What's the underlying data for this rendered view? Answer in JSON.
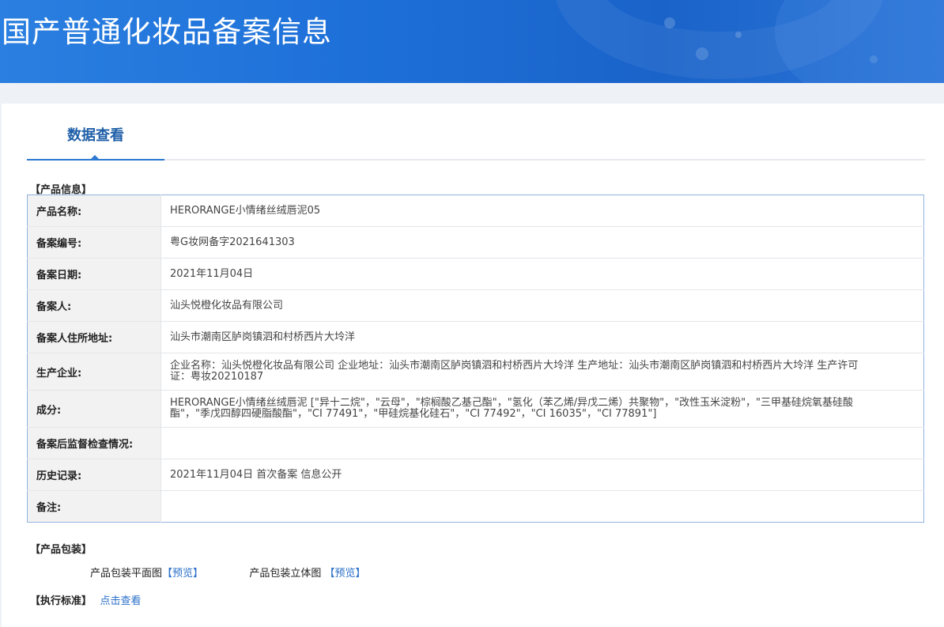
{
  "banner": {
    "title": "国产普通化妆品备案信息"
  },
  "tabs": [
    {
      "label": "数据查看"
    }
  ],
  "product_info": {
    "section_label": "【产品信息】",
    "rows": [
      {
        "label": "产品名称:",
        "value": "HERORANGE小情绪丝绒唇泥05"
      },
      {
        "label": "备案编号:",
        "value": "粤G妆网备字2021641303"
      },
      {
        "label": "备案日期:",
        "value": "2021年11月04日"
      },
      {
        "label": "备案人:",
        "value": "汕头悦橙化妆品有限公司"
      },
      {
        "label": "备案人住所地址:",
        "value": "汕头市潮南区胪岗镇泗和村桥西片大坽洋"
      },
      {
        "label": "生产企业:",
        "value": "企业名称：汕头悦橙化妆品有限公司 企业地址：汕头市潮南区胪岗镇泗和村桥西片大坽洋 生产地址：汕头市潮南区胪岗镇泗和村桥西片大坽洋 生产许可证：粤妆20210187"
      },
      {
        "label": "成分:",
        "value": "HERORANGE小情绪丝绒唇泥 [\"异十二烷\"，\"云母\"，\"棕榈酸乙基己酯\"，\"氢化（苯乙烯/异戊二烯）共聚物\"，\"改性玉米淀粉\"，\"三甲基硅烷氧基硅酸酯\"，\"季戊四醇四硬脂酸酯\"，\"CI 77491\"，\"甲硅烷基化硅石\"，\"CI 77492\"，\"CI 16035\"，\"CI 77891\"]"
      },
      {
        "label": "备案后监督检查情况:",
        "value": ""
      },
      {
        "label": "历史记录:",
        "value": "2021年11月04日 首次备案 信息公开"
      },
      {
        "label": "备注:",
        "value": ""
      }
    ]
  },
  "packaging": {
    "section_label": "【产品包装】",
    "flat_label": "产品包装平面图",
    "flat_link": "【预览】",
    "solid_label": "产品包装立体图",
    "solid_link": "【预览】"
  },
  "standard": {
    "section_label": "【执行标准】",
    "link": "点击查看"
  },
  "colors": {
    "accent": "#2b79d1",
    "tab_text": "#1f5fa8",
    "link": "#2a6fc9",
    "table_border": "#8fb3df"
  }
}
